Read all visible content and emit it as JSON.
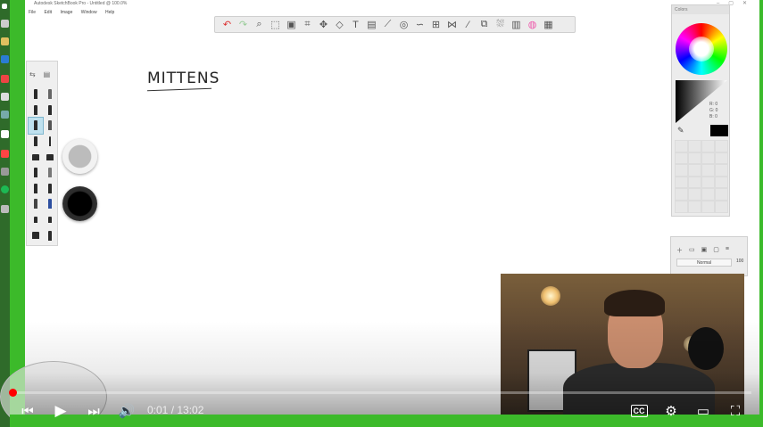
{
  "window": {
    "title": "Autodesk SketchBook Pro - Untitled @ 100.0%",
    "menu": [
      "File",
      "Edit",
      "Image",
      "Window",
      "Help"
    ]
  },
  "canvas": {
    "text": "MITTENS"
  },
  "colors_panel": {
    "title": "Colors",
    "r_label": "R:",
    "r_value": "0",
    "g_label": "G:",
    "g_value": "0",
    "b_label": "B:",
    "b_value": "0",
    "current_color": "#000000"
  },
  "layers_panel": {
    "blend_mode": "Normal",
    "opacity": "100"
  },
  "video": {
    "current_time": "0:01",
    "separator": " / ",
    "duration": "13:02",
    "progress": 0.001,
    "accent_color": "#ff0000"
  },
  "toolbar_icons": [
    "undo-icon",
    "redo-icon",
    "zoom-icon",
    "select-icon",
    "crop-icon",
    "move-icon",
    "distort-icon",
    "text-icon",
    "ruler-icon",
    "ellipse-icon",
    "french-curve-icon",
    "symmetry-icon",
    "perspective-icon",
    "stroke-icon",
    "fill-icon",
    "copic-icon",
    "color-wheel-icon",
    "layers-icon"
  ]
}
